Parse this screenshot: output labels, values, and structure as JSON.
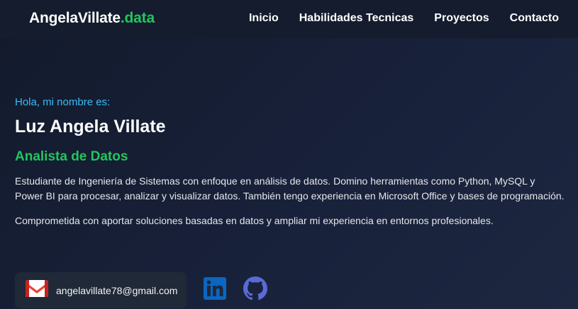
{
  "brand": {
    "name": "AngelaVillate",
    "suffix": ".data"
  },
  "nav": {
    "items": [
      "Inicio",
      "Habilidades Tecnicas",
      "Proyectos",
      "Contacto"
    ]
  },
  "hero": {
    "greeting": "Hola, mi nombre es:",
    "name": "Luz Angela Villate",
    "role": "Analista de Datos",
    "bio": "Estudiante de Ingeniería de Sistemas con enfoque en análisis de datos. Domino herramientas como Python, MySQL y Power BI para procesar, analizar y visualizar datos. También tengo experiencia en Microsoft Office y bases de programación.",
    "bio_extra": "Comprometida con aportar soluciones basadas en datos y ampliar mi experiencia en entornos profesionales."
  },
  "contact": {
    "email": "angelavillate78@gmail.com",
    "email_icon": "gmail-icon",
    "social_icons": [
      "linkedin-icon",
      "github-icon"
    ]
  },
  "colors": {
    "accent_green": "#22c55e",
    "accent_blue": "#38bdf8",
    "navbar_bg": "#141c2e",
    "card_bg": "#1f2937"
  }
}
